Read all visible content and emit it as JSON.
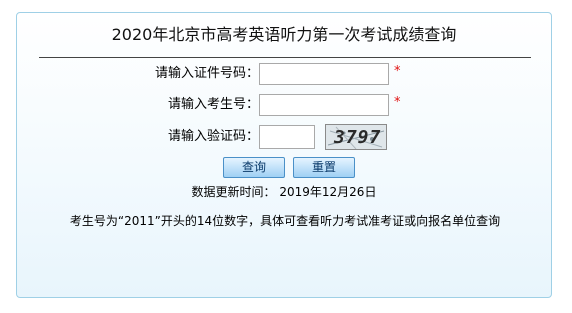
{
  "page_title": "2020年北京市高考英语听力第一次考试成绩查询",
  "form": {
    "id_label": "请输入证件号码：",
    "exam_no_label": "请输入考生号：",
    "captcha_label": "请输入验证码：",
    "id_value": "",
    "exam_no_value": "",
    "captcha_value": "",
    "required_mark": "*",
    "captcha_image_text": "3797"
  },
  "buttons": {
    "query": "查询",
    "reset": "重置"
  },
  "update_time": "数据更新时间： 2019年12月26日",
  "notice": "考生号为“2011”开头的14位数字，具体可查看听力考试准考证或向报名单位查询",
  "colors": {
    "panel_border": "#9fd0e6",
    "required": "#e01010",
    "button_border": "#4a90c8"
  }
}
